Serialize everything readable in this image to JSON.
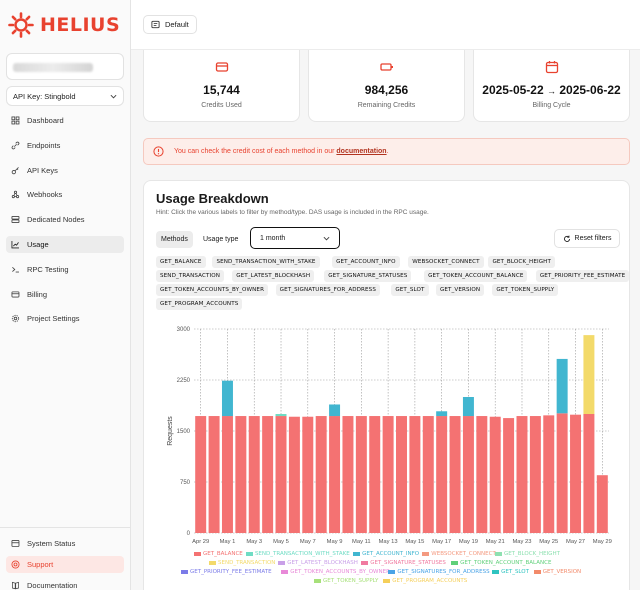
{
  "brand": {
    "name": "HELIUS",
    "accent": "#e8422f"
  },
  "sidebar": {
    "api_key_label": "API Key: Stingbold",
    "items": [
      {
        "label": "Dashboard",
        "icon": "grid-icon"
      },
      {
        "label": "Endpoints",
        "icon": "link-icon"
      },
      {
        "label": "API Keys",
        "icon": "key-icon"
      },
      {
        "label": "Webhooks",
        "icon": "webhook-icon"
      },
      {
        "label": "Dedicated Nodes",
        "icon": "server-icon"
      },
      {
        "label": "Usage",
        "icon": "chart-icon",
        "active": true
      },
      {
        "label": "RPC Testing",
        "icon": "terminal-icon"
      },
      {
        "label": "Billing",
        "icon": "card-icon"
      },
      {
        "label": "Project Settings",
        "icon": "gear-icon"
      }
    ],
    "bottom_items": [
      {
        "label": "System Status",
        "icon": "status-icon"
      },
      {
        "label": "Support",
        "icon": "help-icon"
      },
      {
        "label": "Documentation",
        "icon": "book-icon"
      }
    ]
  },
  "topbar": {
    "project_label": "Default"
  },
  "stats": [
    {
      "value": "15,744",
      "label": "Credits Used",
      "icon": "card-icon"
    },
    {
      "value": "984,256",
      "label": "Remaining Credits",
      "icon": "battery-icon"
    },
    {
      "value_from": "2025-05-22",
      "value_to": "2025-06-22",
      "label": "Billing Cycle",
      "icon": "calendar-icon"
    }
  ],
  "alert": {
    "text": "You can check the credit cost of each method in our ",
    "link": "documentation",
    "suffix": "."
  },
  "usage": {
    "title": "Usage Breakdown",
    "hint": "Hint: Click the various labels to filter by method/type. DAS usage is included in the RPC usage.",
    "tabs": [
      "Methods",
      "Usage type"
    ],
    "range": "1 month",
    "reset": "Reset filters",
    "methods": [
      "GET_BALANCE",
      "SEND_TRANSACTION_WITH_STAKE",
      "GET_ACCOUNT_INFO",
      "WEBSOCKET_CONNECT",
      "GET_BLOCK_HEIGHT",
      "SEND_TRANSACTION",
      "GET_LATEST_BLOCKHASH",
      "GET_SIGNATURE_STATUSES",
      "GET_TOKEN_ACCOUNT_BALANCE",
      "GET_PRIORITY_FEE_ESTIMATE",
      "GET_TOKEN_ACCOUNTS_BY_OWNER",
      "GET_SIGNATURES_FOR_ADDRESS",
      "GET_SLOT",
      "GET_VERSION",
      "GET_TOKEN_SUPPLY",
      "GET_PROGRAM_ACCOUNTS"
    ]
  },
  "chart_data": {
    "type": "bar",
    "stacked": true,
    "ylabel": "Requests",
    "ylim": [
      0,
      3000
    ],
    "yticks": [
      "0",
      "750",
      "1500",
      "2250",
      "3000"
    ],
    "grid": true,
    "legend_position": "bottom",
    "categories": [
      "Apr 29",
      "Apr 30",
      "May 1",
      "May 2",
      "May 3",
      "May 4",
      "May 5",
      "May 6",
      "May 7",
      "May 8",
      "May 9",
      "May 10",
      "May 11",
      "May 12",
      "May 13",
      "May 14",
      "May 15",
      "May 16",
      "May 17",
      "May 18",
      "May 19",
      "May 20",
      "May 21",
      "May 22",
      "May 23",
      "May 24",
      "May 25",
      "May 26",
      "May 27",
      "May 28",
      "May 29"
    ],
    "xtick_labels": [
      "Apr 29",
      "May 1",
      "May 3",
      "May 5",
      "May 7",
      "May 9",
      "May 11",
      "May 13",
      "May 15",
      "May 17",
      "May 19",
      "May 21",
      "May 23",
      "May 25",
      "May 27",
      "May 29"
    ],
    "series": [
      {
        "name": "GET_BALANCE",
        "color": "#f47272",
        "values": [
          1720,
          1720,
          1720,
          1720,
          1720,
          1720,
          1720,
          1710,
          1710,
          1720,
          1720,
          1720,
          1720,
          1720,
          1720,
          1720,
          1720,
          1720,
          1720,
          1720,
          1720,
          1720,
          1710,
          1690,
          1720,
          1720,
          1730,
          1760,
          1740,
          1750,
          850
        ]
      },
      {
        "name": "SEND_TRANSACTION_WITH_STAKE",
        "color": "#6fdcc4",
        "values": [
          0,
          0,
          0,
          0,
          0,
          0,
          30,
          0,
          0,
          0,
          0,
          0,
          0,
          0,
          0,
          0,
          0,
          0,
          0,
          0,
          0,
          0,
          0,
          0,
          0,
          0,
          0,
          0,
          0,
          0,
          0
        ]
      },
      {
        "name": "GET_ACCOUNT_INFO",
        "color": "#41b6d0",
        "values": [
          0,
          0,
          520,
          0,
          0,
          0,
          0,
          0,
          0,
          0,
          170,
          0,
          0,
          0,
          0,
          0,
          0,
          0,
          70,
          0,
          280,
          0,
          0,
          0,
          0,
          0,
          0,
          800,
          0,
          0,
          0
        ]
      },
      {
        "name": "WEBSOCKET_CONNECT",
        "color": "#f49a80",
        "values": [
          0,
          0,
          0,
          0,
          0,
          0,
          0,
          0,
          0,
          0,
          0,
          0,
          0,
          0,
          0,
          0,
          0,
          0,
          0,
          0,
          0,
          0,
          0,
          0,
          0,
          0,
          0,
          0,
          0,
          0,
          0
        ]
      },
      {
        "name": "GET_BLOCK_HEIGHT",
        "color": "#8ee0b0",
        "values": [
          0,
          0,
          0,
          0,
          0,
          0,
          0,
          0,
          0,
          0,
          0,
          0,
          0,
          0,
          0,
          0,
          0,
          0,
          0,
          0,
          0,
          0,
          0,
          0,
          0,
          0,
          0,
          0,
          0,
          0,
          0
        ]
      },
      {
        "name": "SEND_TRANSACTION",
        "color": "#f3da6a",
        "values": [
          0,
          0,
          0,
          0,
          0,
          0,
          0,
          0,
          0,
          0,
          0,
          0,
          0,
          0,
          0,
          0,
          0,
          0,
          0,
          0,
          0,
          0,
          0,
          0,
          0,
          0,
          0,
          0,
          0,
          1160,
          0
        ]
      },
      {
        "name": "GET_LATEST_BLOCKHASH",
        "color": "#c9a0e8",
        "values": [
          0,
          0,
          0,
          0,
          0,
          0,
          0,
          0,
          0,
          0,
          0,
          0,
          0,
          0,
          0,
          0,
          0,
          0,
          0,
          0,
          0,
          0,
          0,
          0,
          0,
          0,
          0,
          0,
          0,
          0,
          0
        ]
      },
      {
        "name": "GET_SIGNATURE_STATUSES",
        "color": "#f07aa0",
        "values": [
          0,
          0,
          0,
          0,
          0,
          0,
          0,
          0,
          0,
          0,
          0,
          0,
          0,
          0,
          0,
          0,
          0,
          0,
          0,
          0,
          0,
          0,
          0,
          0,
          0,
          0,
          0,
          0,
          0,
          0,
          0
        ]
      },
      {
        "name": "GET_TOKEN_ACCOUNT_BALANCE",
        "color": "#5fd07a",
        "values": [
          0,
          0,
          0,
          0,
          0,
          0,
          0,
          0,
          0,
          0,
          0,
          0,
          0,
          0,
          0,
          0,
          0,
          0,
          0,
          0,
          0,
          0,
          0,
          0,
          0,
          0,
          0,
          0,
          0,
          0,
          0
        ]
      },
      {
        "name": "GET_PRIORITY_FEE_ESTIMATE",
        "color": "#7b7be8",
        "values": [
          0,
          0,
          0,
          0,
          0,
          0,
          0,
          0,
          0,
          0,
          0,
          0,
          0,
          0,
          0,
          0,
          0,
          0,
          0,
          0,
          0,
          0,
          0,
          0,
          0,
          0,
          0,
          0,
          0,
          0,
          0
        ]
      },
      {
        "name": "GET_TOKEN_ACCOUNTS_BY_OWNER",
        "color": "#e889d8",
        "values": [
          0,
          0,
          0,
          0,
          0,
          0,
          0,
          0,
          0,
          0,
          0,
          0,
          0,
          0,
          0,
          0,
          0,
          0,
          0,
          0,
          0,
          0,
          0,
          0,
          0,
          0,
          0,
          0,
          0,
          0,
          0
        ]
      },
      {
        "name": "GET_SIGNATURES_FOR_ADDRESS",
        "color": "#4aa3e6",
        "values": [
          0,
          0,
          0,
          0,
          0,
          0,
          0,
          0,
          0,
          0,
          0,
          0,
          0,
          0,
          0,
          0,
          0,
          0,
          0,
          0,
          0,
          0,
          0,
          0,
          0,
          0,
          0,
          0,
          0,
          0,
          0
        ]
      },
      {
        "name": "GET_SLOT",
        "color": "#2fc4c0",
        "values": [
          0,
          0,
          0,
          0,
          0,
          0,
          0,
          0,
          0,
          0,
          0,
          0,
          0,
          0,
          0,
          0,
          0,
          0,
          0,
          0,
          0,
          0,
          0,
          0,
          0,
          0,
          0,
          0,
          0,
          0,
          0
        ]
      },
      {
        "name": "GET_VERSION",
        "color": "#f28a6a",
        "values": [
          0,
          0,
          0,
          0,
          0,
          0,
          0,
          0,
          0,
          0,
          0,
          0,
          0,
          0,
          0,
          0,
          0,
          0,
          0,
          0,
          0,
          0,
          0,
          0,
          0,
          0,
          0,
          0,
          0,
          0,
          0
        ]
      },
      {
        "name": "GET_TOKEN_SUPPLY",
        "color": "#a7e07a",
        "values": [
          0,
          0,
          0,
          0,
          0,
          0,
          0,
          0,
          0,
          0,
          0,
          0,
          0,
          0,
          0,
          0,
          0,
          0,
          0,
          0,
          0,
          0,
          0,
          0,
          0,
          0,
          0,
          0,
          0,
          0,
          0
        ]
      },
      {
        "name": "GET_PROGRAM_ACCOUNTS",
        "color": "#f5cf5a",
        "values": [
          0,
          0,
          0,
          0,
          0,
          0,
          0,
          0,
          0,
          0,
          0,
          0,
          0,
          0,
          0,
          0,
          0,
          0,
          0,
          0,
          0,
          0,
          0,
          0,
          0,
          0,
          0,
          0,
          0,
          0,
          0
        ]
      }
    ]
  }
}
